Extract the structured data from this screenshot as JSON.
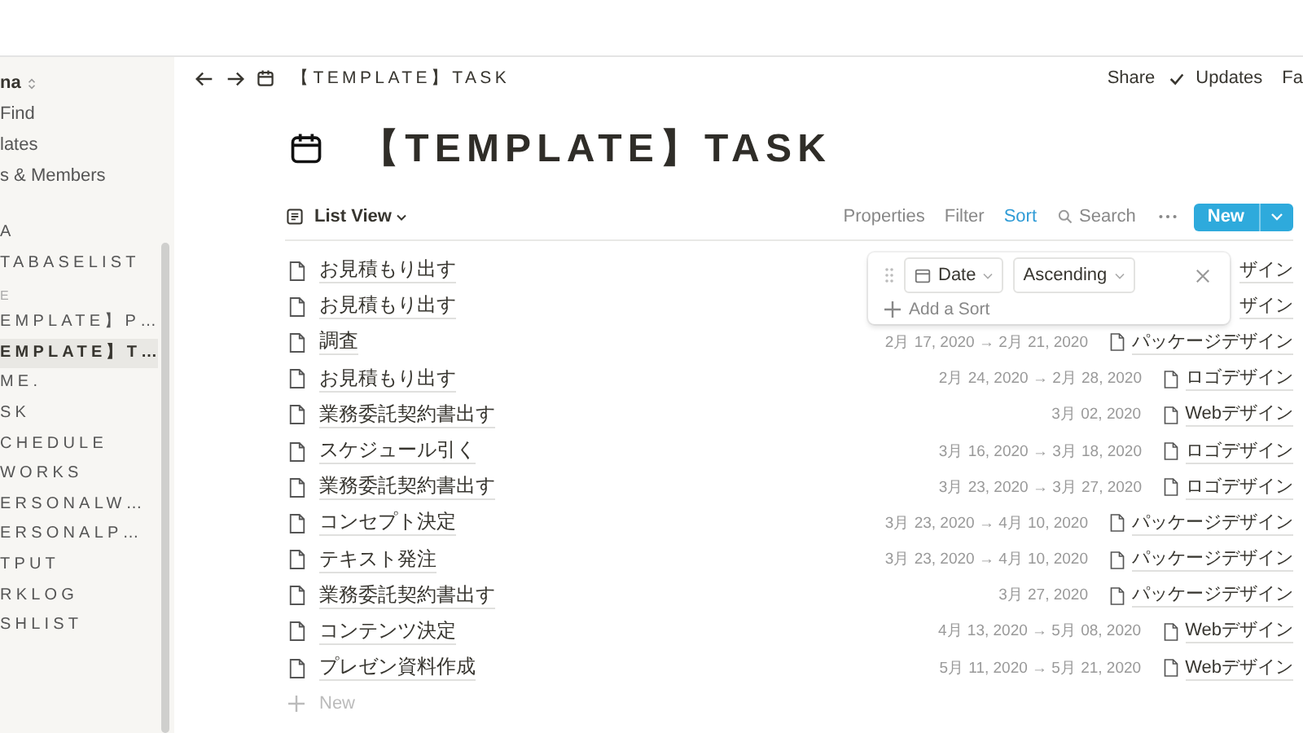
{
  "sidebar": {
    "workspace": "na",
    "nav": [
      "Find",
      "lates",
      "s & Members"
    ],
    "sections": [
      {
        "items": [
          {
            "label": "A",
            "selected": false
          },
          {
            "label": "TABASELIST",
            "selected": false
          }
        ]
      },
      {
        "label": "E",
        "items": [
          {
            "label": "EMPLATE】P…",
            "selected": false
          },
          {
            "label": "EMPLATE】T…",
            "selected": true
          },
          {
            "label": "ME.",
            "selected": false
          },
          {
            "label": "SK",
            "selected": false
          },
          {
            "label": "CHEDULE",
            "selected": false
          },
          {
            "label": "WORKS",
            "selected": false
          },
          {
            "label": "ERSONALW…",
            "selected": false
          },
          {
            "label": "ERSONALP…",
            "selected": false
          },
          {
            "label": "TPUT",
            "selected": false
          },
          {
            "label": "RKLOG",
            "selected": false
          },
          {
            "label": "SHLIST",
            "selected": false
          }
        ]
      }
    ]
  },
  "topbar": {
    "breadcrumb": "【TEMPLATE】TASK",
    "actions": [
      "Share",
      "Updates",
      "Fa"
    ]
  },
  "page": {
    "title": "【TEMPLATE】TASK"
  },
  "view": {
    "name": "List View",
    "tools": [
      {
        "label": "Properties",
        "selected": false
      },
      {
        "label": "Filter",
        "selected": false
      },
      {
        "label": "Sort",
        "selected": true
      }
    ],
    "search": "Search",
    "new_button": "New"
  },
  "rows": [
    {
      "name": "お見積もり出す",
      "tag": "ザイン",
      "tag_icon": false
    },
    {
      "name": "お見積もり出す",
      "tag": "ザイン",
      "tag_icon": false
    },
    {
      "name": "調査",
      "date": "2月 17, 2020 → 2月 21, 2020",
      "tag": "パッケージデザイン",
      "tag_icon": true
    },
    {
      "name": "お見積もり出す",
      "date": "2月 24, 2020 → 2月 28, 2020",
      "tag": "ロゴデザイン",
      "tag_icon": true
    },
    {
      "name": "業務委託契約書出す",
      "date": "3月 02, 2020",
      "tag": "Webデザイン",
      "tag_icon": true
    },
    {
      "name": "スケジュール引く",
      "date": "3月 16, 2020 → 3月 18, 2020",
      "tag": "ロゴデザイン",
      "tag_icon": true
    },
    {
      "name": "業務委託契約書出す",
      "date": "3月 23, 2020 → 3月 27, 2020",
      "tag": "ロゴデザイン",
      "tag_icon": true
    },
    {
      "name": "コンセプト決定",
      "date": "3月 23, 2020 → 4月 10, 2020",
      "tag": "パッケージデザイン",
      "tag_icon": true
    },
    {
      "name": "テキスト発注",
      "date": "3月 23, 2020 → 4月 10, 2020",
      "tag": "パッケージデザイン",
      "tag_icon": true
    },
    {
      "name": "業務委託契約書出す",
      "date": "3月 27, 2020",
      "tag": "パッケージデザイン",
      "tag_icon": true
    },
    {
      "name": "コンテンツ決定",
      "date": "4月 13, 2020 → 5月 08, 2020",
      "tag": "Webデザイン",
      "tag_icon": true
    },
    {
      "name": "プレゼン資料作成",
      "date": "5月 11, 2020 → 5月 21, 2020",
      "tag": "Webデザイン",
      "tag_icon": true
    }
  ],
  "add_row": "New",
  "sort_popup": {
    "property": "Date",
    "direction": "Ascending",
    "add": "Add a Sort"
  }
}
